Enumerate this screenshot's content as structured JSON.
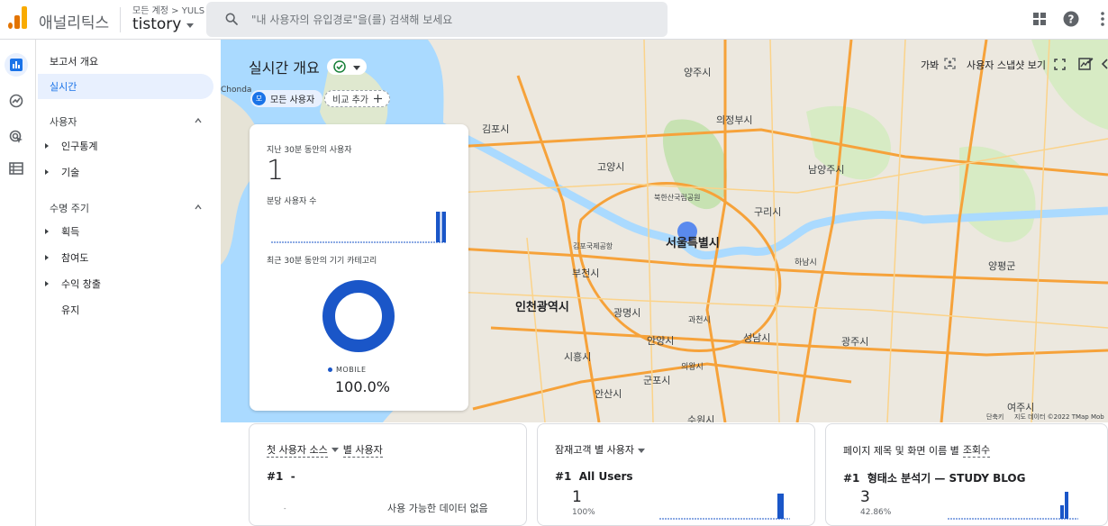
{
  "header": {
    "app_name": "애널리틱스",
    "account_path": "모든 계정 > YULS",
    "account_name": "tistory",
    "search_placeholder": "\"내 사용자의 유입경로\"을(를) 검색해 보세요"
  },
  "sidebar": {
    "reports_overview": "보고서 개요",
    "realtime": "실시간",
    "section_user": "사용자",
    "demographics": "인구통계",
    "tech": "기술",
    "section_lifecycle": "수명 주기",
    "acquisition": "획득",
    "engagement": "참여도",
    "monetization": "수익 창출",
    "retention": "유지"
  },
  "page": {
    "title": "실시간 개요",
    "chip_all_users_badge": "모",
    "chip_all_users": "모든 사용자",
    "compare_add": "비교 추가",
    "toolbar_cut": "가봐",
    "snapshot": "사용자 스냅샷 보기"
  },
  "realtime_card": {
    "users_30min_label": "지난 30분 동안의 사용자",
    "users_30min_value": "1",
    "per_minute_label": "분당 사용자 수",
    "per_minute_values": [
      0,
      0,
      0,
      0,
      0,
      0,
      0,
      0,
      0,
      0,
      0,
      0,
      0,
      0,
      0,
      0,
      0,
      0,
      0,
      0,
      0,
      0,
      0,
      0,
      0,
      0,
      0,
      0,
      1,
      1
    ],
    "device_label": "최근 30분 동안의 기기 카테고리",
    "device_legend": "MOBILE",
    "device_pct": "100.0%",
    "device_share": 1.0
  },
  "map": {
    "labels": [
      "양주시",
      "의정부시",
      "김포시",
      "고양시",
      "남양주시",
      "북한산국립공원",
      "구리시",
      "김포국제공항",
      "서울특별시",
      "부천시",
      "하남시",
      "양평군",
      "인천광역시",
      "광명시",
      "과천시",
      "안양시",
      "성남시",
      "광주시",
      "시흥시",
      "의왕시",
      "군포시",
      "안산시",
      "수원시",
      "여주시",
      "Chonda"
    ],
    "footer_scale": "단축키",
    "footer_copy": "지도 데이터 ©2022 TMap Mob"
  },
  "cards": [
    {
      "title_prefix": "첫 사용자 소스",
      "title_suffix": "별 사용자",
      "rank": "#1",
      "item": "-",
      "empty": "사용 가능한 데이터 없음",
      "number": "",
      "pct": ""
    },
    {
      "title_prefix": "잠재고객 별 사용자",
      "title_suffix": "",
      "rank": "#1",
      "item": "All Users",
      "empty": "",
      "number": "1",
      "pct": "100%"
    },
    {
      "title_prefix": "페이지 제목 및 화면 이름 별",
      "title_suffix": "조회수",
      "rank": "#1",
      "item": "형태소 분석기 — STUDY BLOG",
      "empty": "",
      "number": "3",
      "pct": "42.86%"
    }
  ],
  "colors": {
    "accent": "#1a73e8",
    "bar": "#1a56c8",
    "road": "#f6a23a"
  }
}
